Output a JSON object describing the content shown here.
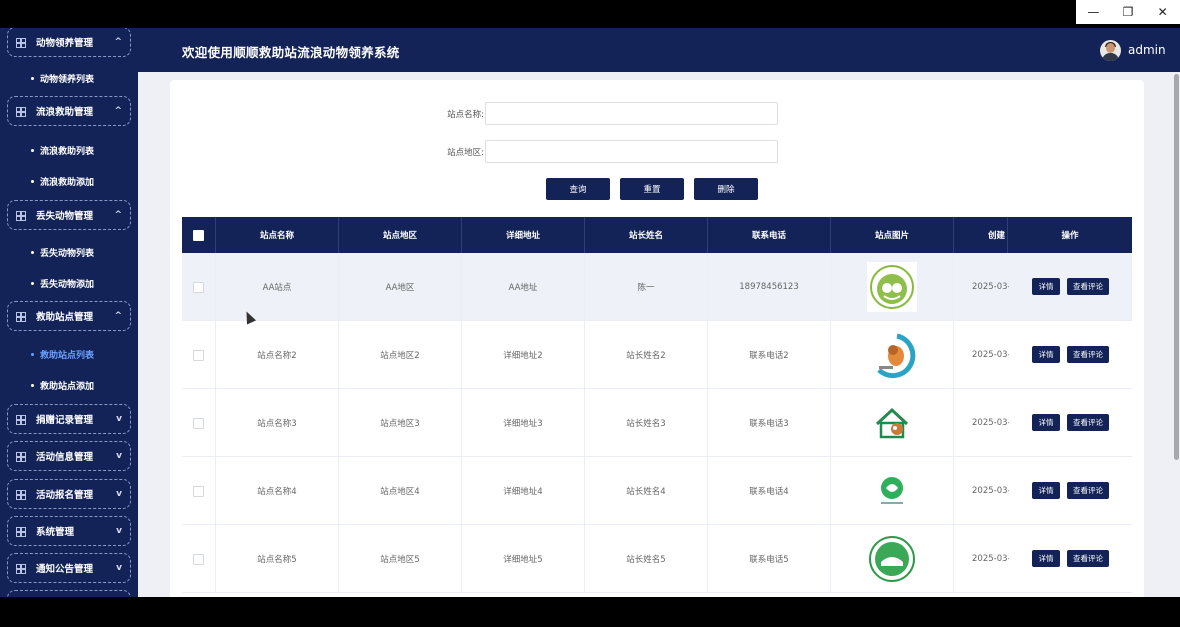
{
  "window": {
    "minimize": "—",
    "restore": "❐",
    "close": "✕"
  },
  "header": {
    "title": "欢迎使用顺顺救助站流浪动物领养系统",
    "user": "admin"
  },
  "sidebar": {
    "groups": [
      {
        "label": "动物领养管理",
        "chevron": "^",
        "items": [
          "动物领养列表"
        ]
      },
      {
        "label": "流浪救助管理",
        "chevron": "^",
        "items": [
          "流浪救助列表",
          "流浪救助添加"
        ]
      },
      {
        "label": "丢失动物管理",
        "chevron": "^",
        "items": [
          "丢失动物列表",
          "丢失动物添加"
        ]
      },
      {
        "label": "救助站点管理",
        "chevron": "^",
        "items": [
          "救助站点列表",
          "救助站点添加"
        ]
      },
      {
        "label": "捐赠记录管理",
        "chevron": "v",
        "items": []
      },
      {
        "label": "活动信息管理",
        "chevron": "v",
        "items": []
      },
      {
        "label": "活动报名管理",
        "chevron": "v",
        "items": []
      },
      {
        "label": "系统管理",
        "chevron": "v",
        "items": []
      },
      {
        "label": "通知公告管理",
        "chevron": "v",
        "items": []
      }
    ],
    "active_item": "救助站点列表"
  },
  "search": {
    "name_label": "站点名称:",
    "region_label": "站点地区:",
    "name_value": "",
    "region_value": "",
    "query_button": "查询",
    "reset_button": "重置",
    "delete_button": "删除"
  },
  "table": {
    "columns": [
      "站点名称",
      "站点地区",
      "详细地址",
      "站长姓名",
      "联系电话",
      "站点图片",
      "创建",
      "操作"
    ],
    "rows": [
      {
        "name": "AA站点",
        "region": "AA地区",
        "address": "AA地址",
        "manager": "陈一",
        "phone": "18978456123",
        "date": "2025-03-",
        "image": "logo-green-circle"
      },
      {
        "name": "站点名称2",
        "region": "站点地区2",
        "address": "详细地址2",
        "manager": "站长姓名2",
        "phone": "联系电话2",
        "date": "2025-03-",
        "image": "logo-dog-blue-arc"
      },
      {
        "name": "站点名称3",
        "region": "站点地区3",
        "address": "详细地址3",
        "manager": "站长姓名3",
        "phone": "联系电话3",
        "date": "2025-03-",
        "image": "logo-house-dog"
      },
      {
        "name": "站点名称4",
        "region": "站点地区4",
        "address": "详细地址4",
        "manager": "站长姓名4",
        "phone": "联系电话4",
        "date": "2025-03-",
        "image": "logo-green-blob"
      },
      {
        "name": "站点名称5",
        "region": "站点地区5",
        "address": "详细地址5",
        "manager": "站长姓名5",
        "phone": "联系电话5",
        "date": "2025-03-",
        "image": "logo-green-seal"
      }
    ],
    "detail_button": "详情",
    "comment_button": "查看评论"
  },
  "colors": {
    "navy": "#132358",
    "active_link": "#6aa0ff",
    "page_bg": "#eef0f5"
  }
}
